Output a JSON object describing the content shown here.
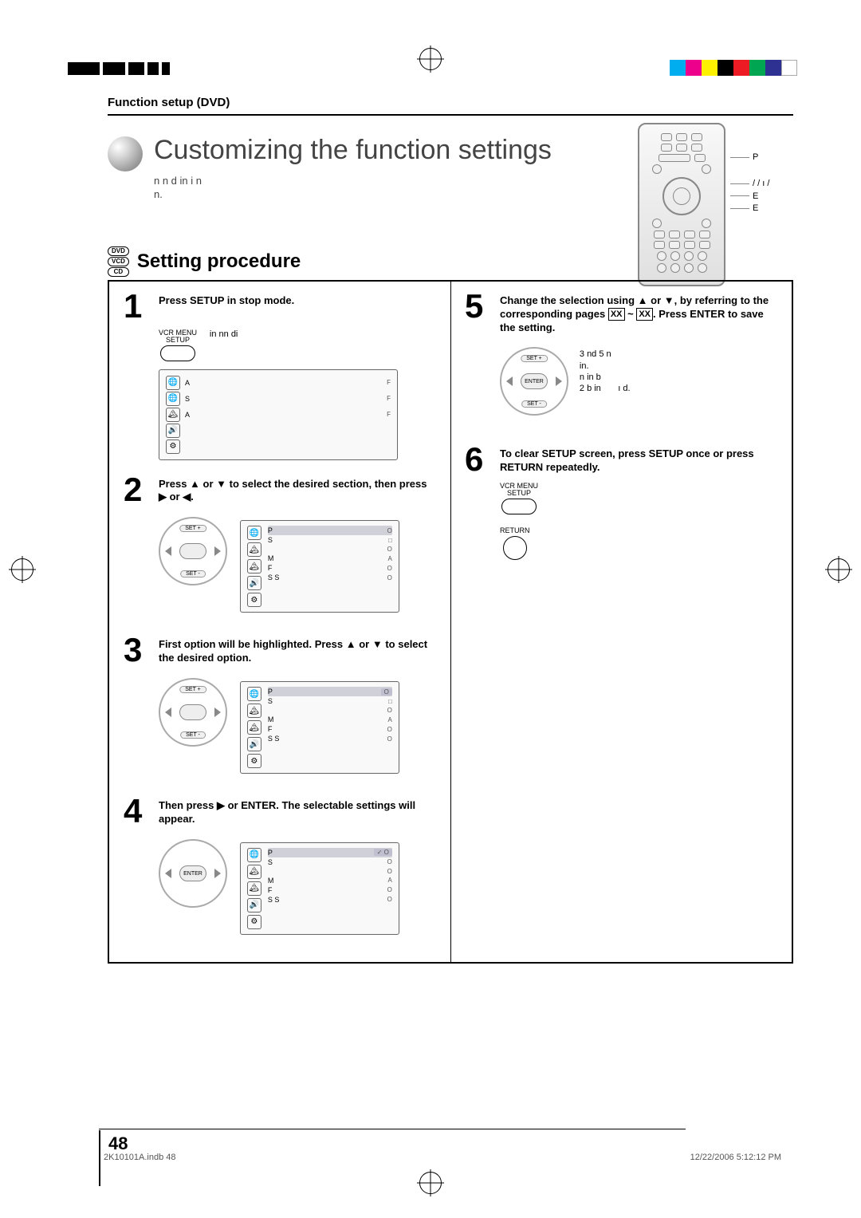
{
  "header": {
    "section": "Function setup (DVD)",
    "title": "Customizing the function settings",
    "subtitle1": "n n d in i n",
    "subtitle2": "n."
  },
  "discs": {
    "d1": "DVD",
    "d2": "VCD",
    "d3": "CD"
  },
  "proc_title": "Setting procedure",
  "remote": {
    "l1": "P",
    "l2": "/ / ı /",
    "l3": "E",
    "l4": "E"
  },
  "step1": {
    "num": "1",
    "text": "Press SETUP in stop mode.",
    "btn_top": "VCR MENU",
    "btn_bot": "SETUP",
    "cap": "in nn di",
    "osd": [
      {
        "icon": "🌐",
        "label": "A",
        "value": "F"
      },
      {
        "icon": "🌐",
        "label": "S",
        "value": "F"
      },
      {
        "icon": "🏔",
        "label": "A",
        "value": "F"
      },
      {
        "icon": "🔊",
        "label": "",
        "value": ""
      },
      {
        "icon": "⚙",
        "label": "",
        "value": ""
      }
    ]
  },
  "step2": {
    "num": "2",
    "text_a": "Press ",
    "text_b": " or ",
    "text_c": " to select the desired section, then press ",
    "text_d": " or ",
    "text_e": ".",
    "set_top": "SET +",
    "set_bot": "SET -",
    "osd": [
      {
        "icon": "🌐",
        "label": "P",
        "value": "O",
        "hl": true
      },
      {
        "icon": "🏔",
        "label": "S",
        "value": "□"
      },
      {
        "icon": "🏔",
        "label": "",
        "value": "O"
      },
      {
        "icon": "🔊",
        "label": "M",
        "value": "A"
      },
      {
        "icon": "⚙",
        "label": "F",
        "value": "O"
      },
      {
        "icon": "⚙",
        "label": "S S",
        "value": "O"
      }
    ]
  },
  "step3": {
    "num": "3",
    "text_a": "First option will be highlighted. Press ",
    "text_b": " or ",
    "text_c": " to select the desired option.",
    "osd": [
      {
        "icon": "🌐",
        "label": "P",
        "value": "O",
        "hl": true,
        "hv": true
      },
      {
        "icon": "🏔",
        "label": "S",
        "value": "□"
      },
      {
        "icon": "🏔",
        "label": "",
        "value": "O"
      },
      {
        "icon": "🔊",
        "label": "M",
        "value": "A"
      },
      {
        "icon": "⚙",
        "label": "F",
        "value": "O"
      },
      {
        "icon": "⚙",
        "label": "S S",
        "value": "O"
      }
    ]
  },
  "step4": {
    "num": "4",
    "text_a": "Then press ",
    "text_b": " or ENTER. The selectable settings will appear.",
    "center": "ENTER",
    "osd": [
      {
        "icon": "🌐",
        "label": "P",
        "value": "✓ O",
        "hl": true,
        "hv": true
      },
      {
        "icon": "🏔",
        "label": "S",
        "value": "O"
      },
      {
        "icon": "🏔",
        "label": "",
        "value": "O"
      },
      {
        "icon": "🔊",
        "label": "M",
        "value": "A"
      },
      {
        "icon": "⚙",
        "label": "F",
        "value": "O"
      },
      {
        "icon": "⚙",
        "label": "S S",
        "value": "O"
      }
    ]
  },
  "step5": {
    "num": "5",
    "text_a": "Change the selection using ",
    "text_b": " or ",
    "text_c": ", by referring to the corresponding pages ",
    "text_d": " ~ ",
    "text_e": ". Press ENTER to save the setting.",
    "pg1": "XX",
    "pg2": "XX",
    "set_top": "SET +",
    "center": "ENTER",
    "set_bot": "SET -",
    "note1": "3 nd 5 n",
    "note2": "in.",
    "note3": "n in b",
    "note4": "2 b in",
    "note5": "ı d."
  },
  "step6": {
    "num": "6",
    "text": "To clear SETUP screen, press SETUP once or press RETURN repeatedly.",
    "btn_top": "VCR MENU",
    "btn_bot": "SETUP",
    "return_lbl": "RETURN"
  },
  "page_num": "48",
  "footer_left": "2K10101A.indb   48",
  "footer_right": "12/22/2006   5:12:12 PM",
  "colors": [
    "#00AEEF",
    "#EC008C",
    "#FFF200",
    "#000000",
    "#ED1C24",
    "#00A651",
    "#2E3192",
    "#FFFFFF"
  ]
}
